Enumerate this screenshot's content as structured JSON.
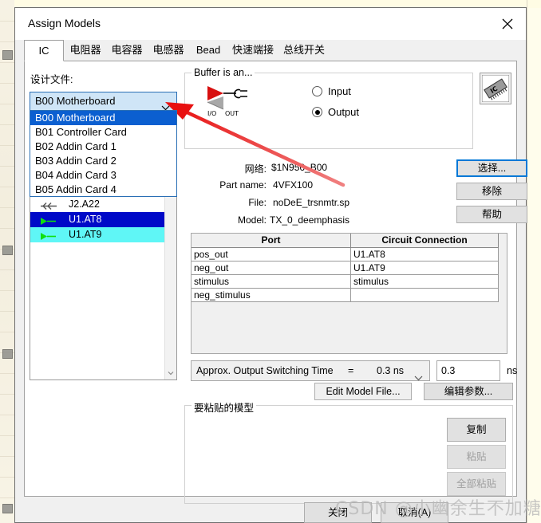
{
  "window": {
    "title": "Assign Models",
    "close_icon": "close-icon"
  },
  "tabs": [
    {
      "label": "IC",
      "active": true
    },
    {
      "label": "电阻器",
      "active": false
    },
    {
      "label": "电容器",
      "active": false
    },
    {
      "label": "电感器",
      "active": false
    },
    {
      "label": "Bead",
      "active": false
    },
    {
      "label": "快速端接",
      "active": false
    },
    {
      "label": "总线开关",
      "active": false
    }
  ],
  "left": {
    "design_file_label": "设计文件:",
    "combo_value": "B00 Motherboard",
    "combo_chevron_icon": "chevron-down-icon",
    "dropdown_options": [
      "B00 Motherboard",
      "B01 Controller Card",
      "B02 Addin Card 1",
      "B03 Addin Card 2",
      "B04 Addin Card 3",
      "B05 Addin Card 4"
    ],
    "dropdown_selected_index": 0,
    "net_rows": [
      {
        "name": "J2.A22",
        "glyph": "input-pin-icon",
        "state": "normal"
      },
      {
        "name": "U1.AT8",
        "glyph": "output-pin-icon",
        "state": "selected-blue"
      },
      {
        "name": "U1.AT9",
        "glyph": "output-pin-icon",
        "state": "selected-cyan"
      }
    ],
    "scroll_down_icon": "chevron-down-icon"
  },
  "buffer_group": {
    "title": "Buffer is an...",
    "symbol_icon": "io-out-buffer-icon",
    "symbol_caption_left": "I/O",
    "symbol_caption_right": "OUT",
    "radios": [
      {
        "label": "Input",
        "checked": false
      },
      {
        "label": "Output",
        "checked": true
      }
    ],
    "chip_icon": "ic-chip-icon"
  },
  "model_info": [
    {
      "label": "网络:",
      "value": "$1N956_B00"
    },
    {
      "label": "Part name:",
      "value": "4VFX100"
    },
    {
      "label": "File:",
      "value": "noDeE_trsnmtr.sp"
    },
    {
      "label": "Model:",
      "value": "TX_0_deemphasis"
    }
  ],
  "side_buttons": [
    {
      "label": "选择...",
      "focused": true,
      "disabled": false
    },
    {
      "label": "移除",
      "focused": false,
      "disabled": false
    },
    {
      "label": "帮助",
      "focused": false,
      "disabled": false
    }
  ],
  "port_table": {
    "headers": [
      "Port",
      "Circuit Connection"
    ],
    "rows": [
      {
        "port": "pos_out",
        "connection": "U1.AT8"
      },
      {
        "port": "neg_out",
        "connection": "U1.AT9"
      },
      {
        "port": "stimulus",
        "connection": "stimulus"
      },
      {
        "port": "neg_stimulus",
        "connection": ""
      }
    ]
  },
  "switching": {
    "label": "Approx. Output Switching Time",
    "equals": "=",
    "combo_value": "0.3 ns",
    "combo_chevron_icon": "chevron-down-icon",
    "input_value": "0.3",
    "unit": "ns"
  },
  "edit_buttons": [
    {
      "label": "Edit Model File..."
    },
    {
      "label": "编辑参数..."
    }
  ],
  "paste_group": {
    "title": "要粘贴的模型",
    "buttons": [
      {
        "label": "复制",
        "disabled": false
      },
      {
        "label": "粘贴",
        "disabled": true
      },
      {
        "label": "全部粘贴",
        "disabled": true
      }
    ]
  },
  "footer_buttons": [
    {
      "label": "关闭",
      "disabled": false
    },
    {
      "label": "取消(A)",
      "disabled": false
    }
  ],
  "watermark": "CSDN @小幽余生不加糖",
  "colors": {
    "accent_blue": "#0078d7",
    "selection_blue": "#0009c8",
    "selection_cyan": "#5ff6f6",
    "annotation_red": "#e81010",
    "dialog_bg": "#f0f0f0",
    "desktop_bg": "#fffdec"
  }
}
